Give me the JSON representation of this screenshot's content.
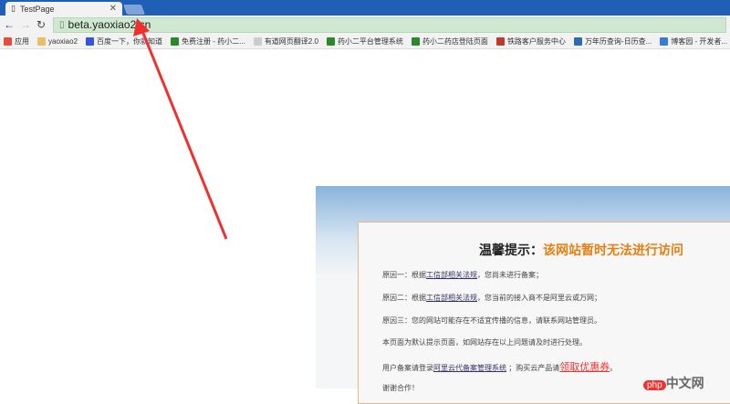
{
  "tab": {
    "title": "TestPage",
    "close": "✕"
  },
  "toolbar": {
    "url": "beta.yaoxiao2.cn"
  },
  "bookmarks": [
    {
      "label": "应用",
      "color": "#e74c3c"
    },
    {
      "label": "yaoxiao2",
      "color": "#e8c060"
    },
    {
      "label": "百度一下，你就知道",
      "color": "#3355dd"
    },
    {
      "label": "免费注册 - 药小二...",
      "color": "#2a8a2a"
    },
    {
      "label": "有道网页翻译2.0",
      "color": "#cccccc"
    },
    {
      "label": "药小二平台管理系统",
      "color": "#2a8a2a"
    },
    {
      "label": "药小二药店登陆页面",
      "color": "#2a8a2a"
    },
    {
      "label": "铁路客户服务中心",
      "color": "#c0392b"
    },
    {
      "label": "万年历查询-日历查...",
      "color": "#2a6db5"
    },
    {
      "label": "博客园 - 开发者...",
      "color": "#3a7bd5"
    }
  ],
  "notice": {
    "title_black": "温馨提示：",
    "title_orange": "该网站暂时无法进行访问",
    "r1a": "原因一：根据",
    "r1link": "工信部相关法规",
    "r1b": "，您尚未进行备案；",
    "r2a": "原因二：根据",
    "r2link": "工信部相关法规",
    "r2b": "，您当前的接入商不是阿里云或万网；",
    "r3": "原因三：您的网站可能存在不适宜传播的信息，请联系网站管理员。",
    "r4": "本页面为默认提示页面，如网站存在以上问题请及时进行处理。",
    "r5a": "用户备案请登录",
    "r5link": "阿里云代备案管理系统",
    "r5b": " ；购买云产品请",
    "r5red": "领取优惠券",
    "r5c": "。",
    "r6": "谢谢合作！"
  },
  "watermark": {
    "badge": "php",
    "text": "中文网"
  }
}
